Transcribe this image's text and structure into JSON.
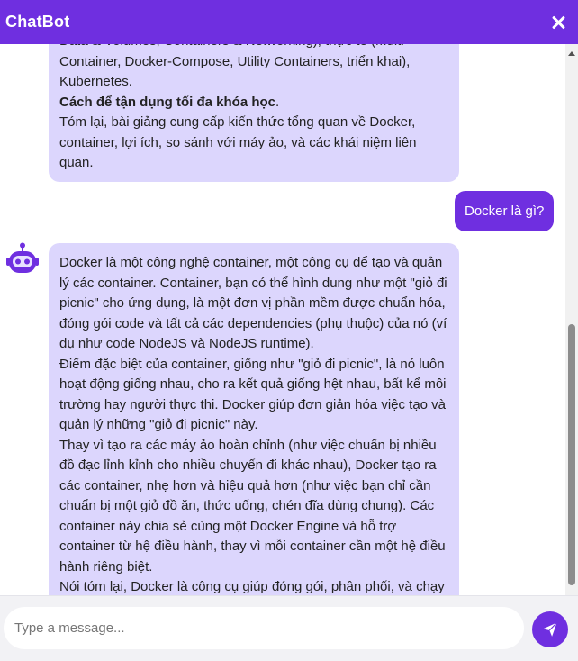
{
  "header": {
    "title": "ChatBot",
    "close_icon": "close-icon"
  },
  "messages": [
    {
      "role": "bot",
      "paragraphs": [
        "Data & Volumes, Containers & Networking), thực tế (Multi-Container, Docker-Compose, Utility Containers, triển khai), Kubernetes.",
        "Tóm lại, bài giảng cung cấp kiến thức tổng quan về Docker, container, lợi ích, so sánh với máy ảo, và các khái niệm liên quan."
      ],
      "bold_line": "Cách để tận dụng tối đa khóa học",
      "bold_suffix": "."
    },
    {
      "role": "user",
      "text": "Docker là gì?"
    },
    {
      "role": "bot",
      "avatar_icon": "robot-icon",
      "paragraphs": [
        "Docker là một công nghệ container, một công cụ để tạo và quản lý các container. Container, bạn có thể hình dung như một \"giỏ đi picnic\" cho ứng dụng, là một đơn vị phần mềm được chuẩn hóa, đóng gói code và tất cả các dependencies (phụ thuộc) của nó (ví dụ như code NodeJS và NodeJS runtime).",
        "Điểm đặc biệt của container, giống như \"giỏ đi picnic\", là nó luôn hoạt động giống nhau, cho ra kết quả giống hệt nhau, bất kể môi trường hay người thực thi. Docker giúp đơn giản hóa việc tạo và quản lý những \"giỏ đi picnic\" này.",
        "Thay vì tạo ra các máy ảo hoàn chỉnh (như việc chuẩn bị nhiều đồ đạc lỉnh kỉnh cho nhiều chuyến đi khác nhau), Docker tạo ra các container, nhẹ hơn và hiệu quả hơn (như việc bạn chỉ cần chuẩn bị một giỏ đồ ăn, thức uống, chén đĩa dùng chung). Các container này chia sẻ cùng một Docker Engine và hỗ trợ container từ hệ điều hành, thay vì mỗi container cần một hệ điều hành riêng biệt.",
        "Nói tóm lại, Docker là công cụ giúp đóng gói, phân phối, và chạy"
      ]
    }
  ],
  "composer": {
    "placeholder": "Type a message...",
    "value": "",
    "send_icon": "send-icon"
  },
  "colors": {
    "accent": "#6f2fe0",
    "bot_bubble": "#dcd6fd",
    "user_bubble": "#6f2fe0",
    "input_bar": "#f2f2f5"
  }
}
